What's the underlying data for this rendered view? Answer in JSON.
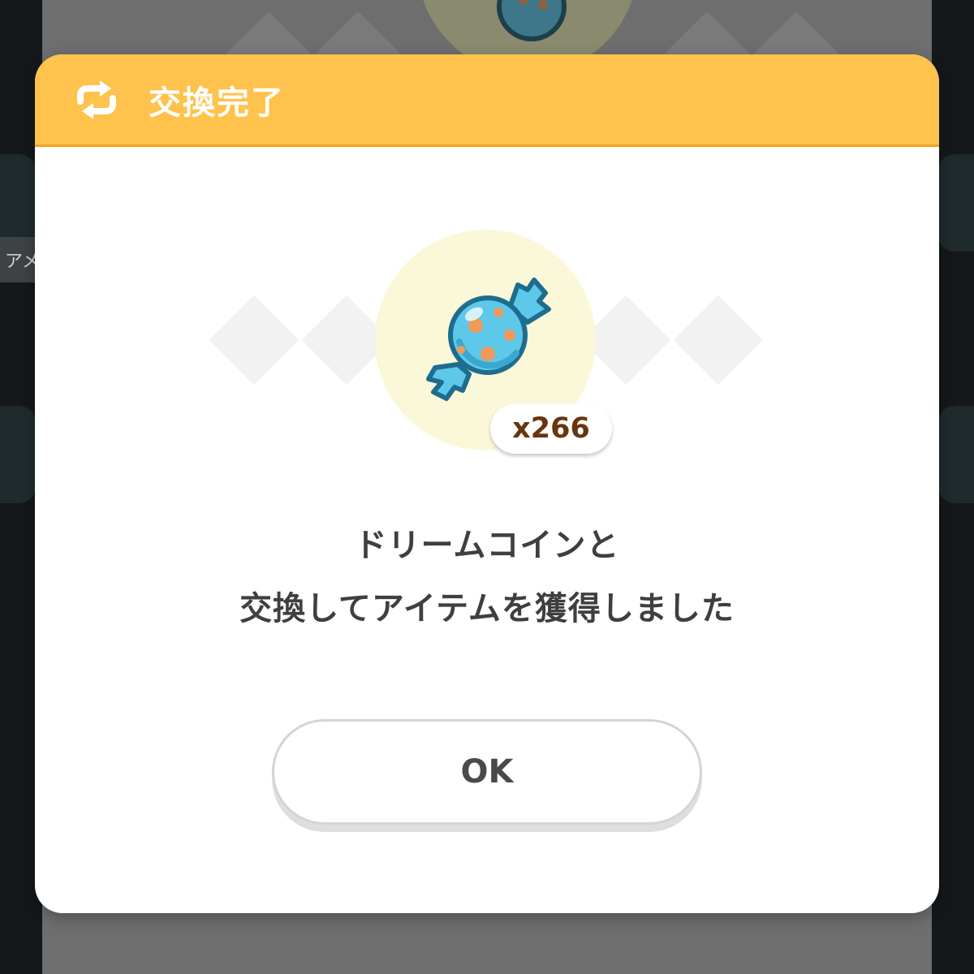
{
  "background": {
    "side_label": "アメ"
  },
  "dialog": {
    "title": "交換完了",
    "header_icon": "exchange-arrows-icon",
    "item": {
      "icon": "candy-icon",
      "count": "x266"
    },
    "message_line1": "ドリームコインと",
    "message_line2": "交換してアイテムを獲得しました",
    "ok_label": "OK"
  },
  "colors": {
    "header": "#ffc24d",
    "header_border": "#f0a21c",
    "candy_body": "#5ec8ea",
    "candy_dots": "#f0995a",
    "candy_outline": "#1e6d8e",
    "count_text": "#6a340e",
    "glow": "#fbf8d9"
  }
}
